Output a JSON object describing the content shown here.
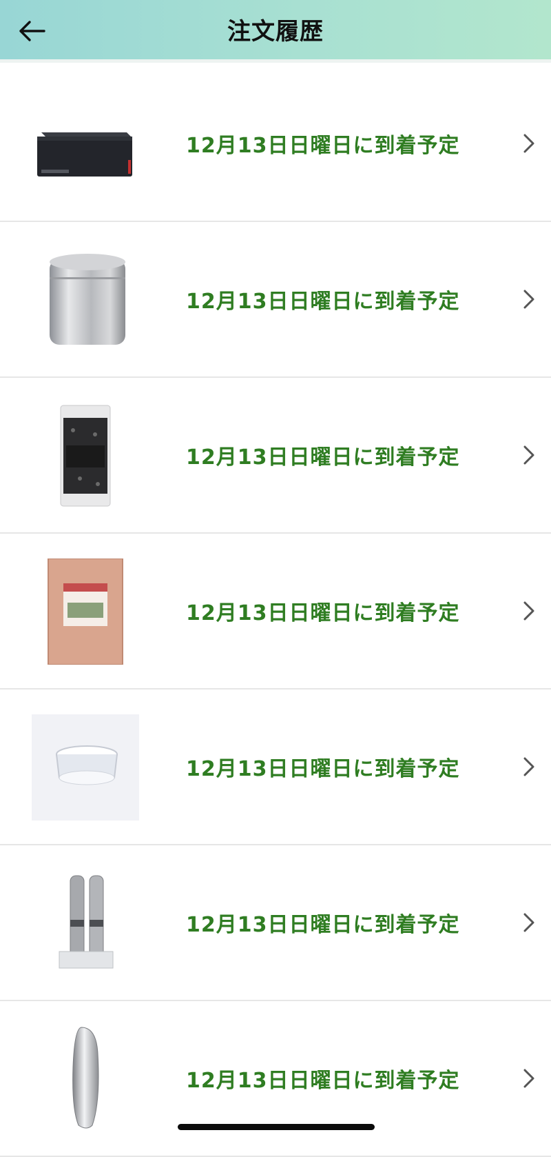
{
  "header": {
    "title": "注文履歴",
    "back_icon": "arrow-left-icon",
    "colors": {
      "gradient_start": "#98d6d5",
      "gradient_end": "#b2e6cd"
    }
  },
  "orders": [
    {
      "status": "12月13日日曜日に到着予定",
      "image": "external-hdd-image"
    },
    {
      "status": "12月13日日曜日に到着予定",
      "image": "steel-canister-image"
    },
    {
      "status": "12月13日日曜日に到着予定",
      "image": "black-pepper-pouch-image"
    },
    {
      "status": "12月13日日曜日に到着予定",
      "image": "rose-salt-bag-image"
    },
    {
      "status": "12月13日日曜日に到着予定",
      "image": "glass-dish-image"
    },
    {
      "status": "12月13日日曜日に到着予定",
      "image": "pepper-mill-set-image"
    },
    {
      "status": "12月13日日曜日に到着予定",
      "image": "metal-spoon-image"
    }
  ],
  "colors": {
    "status_text": "#2f7d22",
    "chevron": "#555555"
  }
}
